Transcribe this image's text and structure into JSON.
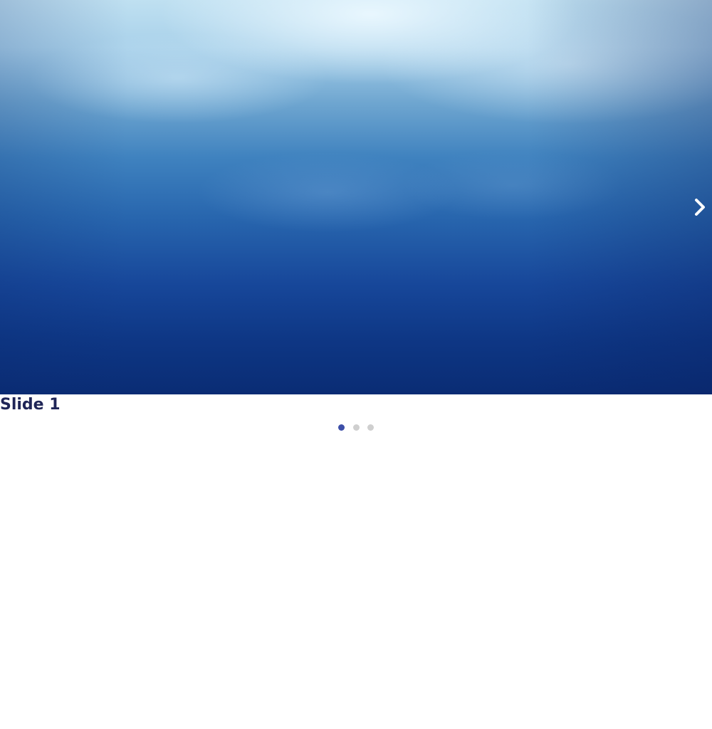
{
  "carousel": {
    "slide_title": "Slide 1",
    "next_icon": "chevron-right-icon",
    "pagination": {
      "total": 3,
      "active_index": 0
    },
    "colors": {
      "title": "#1f2557",
      "dot_active": "#3d4fa8",
      "dot_inactive": "#cfcfcf"
    }
  }
}
